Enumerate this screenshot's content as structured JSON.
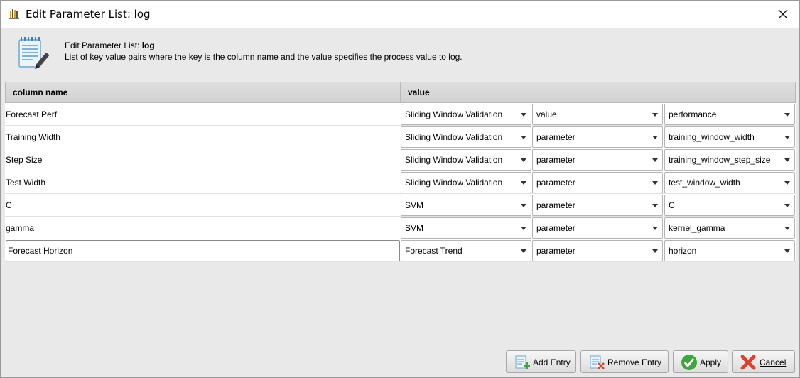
{
  "window": {
    "title": "Edit Parameter List: log",
    "close_icon": "close-icon"
  },
  "header": {
    "title_prefix": "Edit Parameter List: ",
    "title_name": "log",
    "description": "List of key value pairs where the key is the column name and the value specifies the process value to log."
  },
  "table": {
    "columns": [
      "column name",
      "value"
    ],
    "rows": [
      {
        "name": "Forecast Perf",
        "operator": "Sliding Window Validation",
        "type": "value",
        "param": "performance"
      },
      {
        "name": "Training Width",
        "operator": "Sliding Window Validation",
        "type": "parameter",
        "param": "training_window_width"
      },
      {
        "name": "Step Size",
        "operator": "Sliding Window Validation",
        "type": "parameter",
        "param": "training_window_step_size"
      },
      {
        "name": "Test Width",
        "operator": "Sliding Window Validation",
        "type": "parameter",
        "param": "test_window_width"
      },
      {
        "name": "C",
        "operator": "SVM",
        "type": "parameter",
        "param": "C"
      },
      {
        "name": "gamma",
        "operator": "SVM",
        "type": "parameter",
        "param": "kernel_gamma"
      },
      {
        "name": "Forecast Horizon",
        "operator": "Forecast Trend",
        "type": "parameter",
        "param": "horizon"
      }
    ]
  },
  "buttons": {
    "add_entry": "Add Entry",
    "remove_entry": "Remove Entry",
    "apply": "Apply",
    "cancel": "Cancel"
  },
  "colors": {
    "apply_check": "#3ea63e",
    "cancel_x": "#d9432f",
    "add_plus": "#3ea63e",
    "remove_x": "#d9432f"
  }
}
